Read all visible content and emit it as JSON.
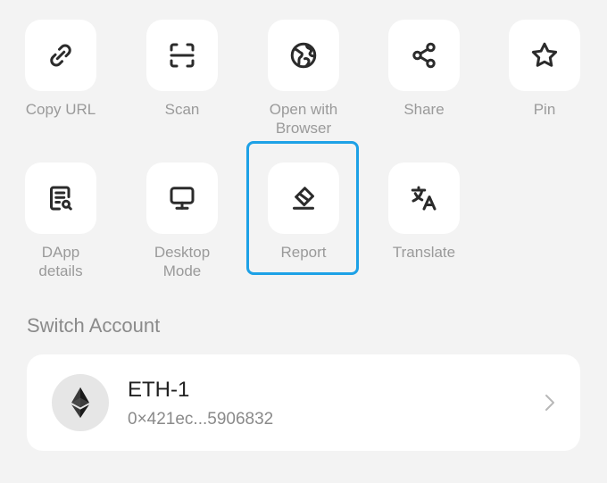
{
  "actions": [
    {
      "label": "Copy URL",
      "icon": "link-icon"
    },
    {
      "label": "Scan",
      "icon": "scan-icon"
    },
    {
      "label": "Open with\nBrowser",
      "icon": "globe-icon"
    },
    {
      "label": "Share",
      "icon": "share-icon"
    },
    {
      "label": "Pin",
      "icon": "star-icon"
    },
    {
      "label": "DApp\ndetails",
      "icon": "document-search-icon"
    },
    {
      "label": "Desktop\nMode",
      "icon": "monitor-icon"
    },
    {
      "label": "Report",
      "icon": "eraser-icon"
    },
    {
      "label": "Translate",
      "icon": "translate-icon"
    }
  ],
  "highlight_color": "#1da1e6",
  "switch_account": {
    "title": "Switch Account",
    "account": {
      "name": "ETH-1",
      "address": "0×421ec...5906832",
      "icon": "ethereum-icon"
    }
  }
}
